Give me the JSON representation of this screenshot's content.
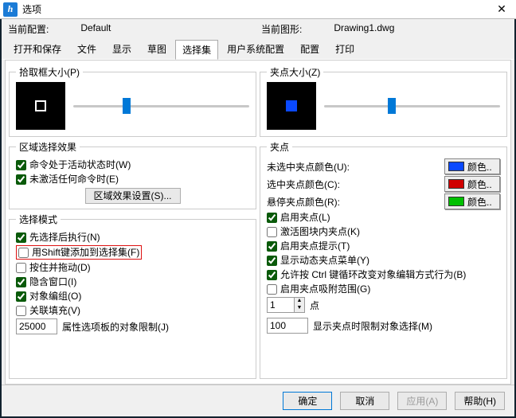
{
  "window": {
    "title": "选项",
    "close": "✕"
  },
  "header": {
    "curr_config_label": "当前配置:",
    "curr_config_value": "Default",
    "curr_drawing_label": "当前图形:",
    "curr_drawing_value": "Drawing1.dwg"
  },
  "tabs": {
    "open_save": "打开和保存",
    "file": "文件",
    "display": "显示",
    "draft": "草图",
    "selection": "选择集",
    "user_sys": "用户系统配置",
    "config": "配置",
    "print": "打印"
  },
  "left": {
    "pickbox_title": "拾取框大小(P)",
    "region_effect_title": "区域选择效果",
    "chk_active_cmd": "命令处于活动状态时(W)",
    "chk_no_cmd": "未激活任何命令时(E)",
    "region_settings_btn": "区域效果设置(S)...",
    "select_mode_title": "选择模式",
    "chk_select_first": "先选择后执行(N)",
    "chk_shift_add": "用Shift键添加到选择集(F)",
    "chk_press_drag": "按住并拖动(D)",
    "chk_implied_win": "隐含窗口(I)",
    "chk_obj_group": "对象编组(O)",
    "chk_assoc_fill": "关联填充(V)",
    "limit_value": "25000",
    "limit_label": "属性选项板的对象限制(J)"
  },
  "right": {
    "gripsize_title": "夹点大小(Z)",
    "grip_section_title": "夹点",
    "lbl_unsel_color": "未选中夹点颜色(U):",
    "lbl_sel_color": "选中夹点颜色(C):",
    "lbl_hover_color": "悬停夹点颜色(R):",
    "color_btn_label": "颜色..",
    "unsel_color": "#0a49ff",
    "sel_color": "#d00000",
    "hover_color": "#00c000",
    "chk_enable_grips": "启用夹点(L)",
    "chk_block_grips": "激活图块内夹点(K)",
    "chk_grip_tips": "启用夹点提示(T)",
    "chk_dyn_grip_menu": "显示动态夹点菜单(Y)",
    "chk_ctrl_cycle": "允许按 Ctrl 键循环改变对象编辑方式行为(B)",
    "chk_grip_snap": "启用夹点吸附范围(G)",
    "spin_value": "1",
    "spin_label": "点",
    "grip_limit_value": "100",
    "grip_limit_label": "显示夹点时限制对象选择(M)"
  },
  "buttons": {
    "ok": "确定",
    "cancel": "取消",
    "apply": "应用(A)",
    "help": "帮助(H)"
  }
}
